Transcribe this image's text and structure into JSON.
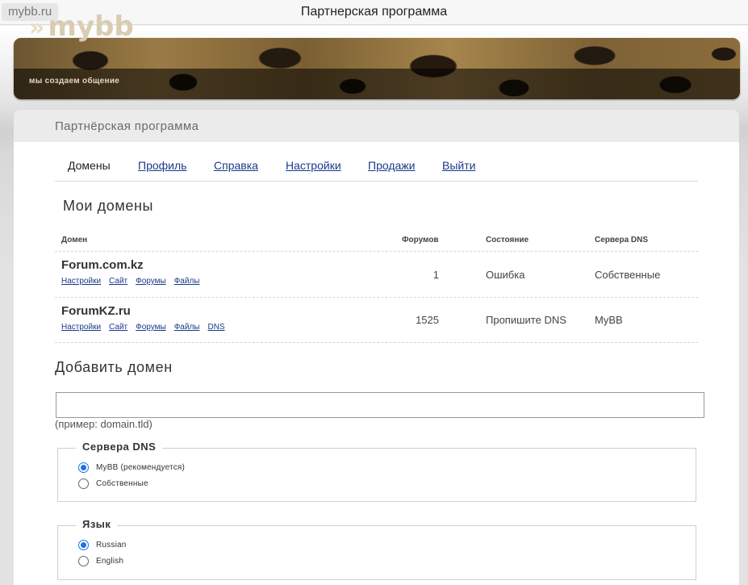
{
  "browser": {
    "domain": "mybb.ru",
    "title": "Партнерская программа"
  },
  "banner": {
    "logo_mark": "»",
    "logo_text": "mybb",
    "slogan": "мы создаем общение"
  },
  "card": {
    "title": "Партнёрская программа"
  },
  "tabs": [
    {
      "label": "Домены",
      "active": true
    },
    {
      "label": "Профиль",
      "active": false
    },
    {
      "label": "Справка",
      "active": false
    },
    {
      "label": "Настройки",
      "active": false
    },
    {
      "label": "Продажи",
      "active": false
    },
    {
      "label": "Выйти",
      "active": false
    }
  ],
  "domains": {
    "title": "Мои домены",
    "columns": {
      "domain": "Домен",
      "forums": "Форумов",
      "state": "Состояние",
      "dns": "Сервера DNS"
    },
    "rows": [
      {
        "name": "Forum.com.kz",
        "links": [
          "Настройки",
          "Сайт",
          "Форумы",
          "Файлы"
        ],
        "forums": "1",
        "state": "Ошибка",
        "dns": "Собственные"
      },
      {
        "name": "ForumKZ.ru",
        "links": [
          "Настройки",
          "Сайт",
          "Форумы",
          "Файлы",
          "DNS"
        ],
        "forums": "1525",
        "state": "Пропишите DNS",
        "dns": "MyBB"
      }
    ]
  },
  "add_domain": {
    "title": "Добавить домен",
    "input_value": "",
    "hint": "(пример: domain.tld)",
    "dns_group": {
      "legend": "Сервера DNS",
      "options": [
        {
          "label": "MyBB (рекомендуется)",
          "checked": true
        },
        {
          "label": "Собственные",
          "checked": false
        }
      ]
    },
    "language_group": {
      "legend": "Язык",
      "options": [
        {
          "label": "Russian",
          "checked": true
        },
        {
          "label": "English",
          "checked": false
        }
      ]
    }
  }
}
